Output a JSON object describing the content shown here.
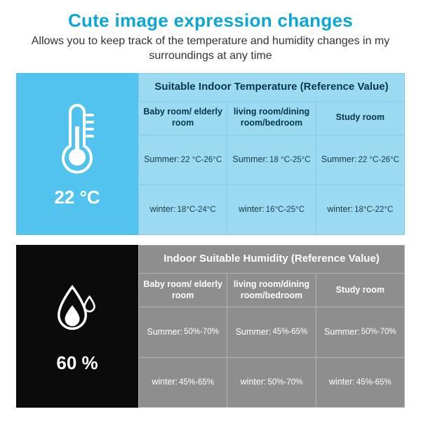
{
  "header": {
    "title": "Cute image expression changes",
    "subtitle": "Allows you to keep track of the temperature and humidity changes in my surroundings at any time"
  },
  "temperature": {
    "reading": "22 °C",
    "table_title": "Suitable Indoor Temperature (Reference Value)",
    "columns": [
      "Baby room/\nelderly room",
      "living room/dining room/bedroom",
      "Study room"
    ],
    "rows": [
      {
        "season": "Summer:",
        "values": [
          "22 °C-26°C",
          "18 °C-25°C",
          "22 °C-26°C"
        ]
      },
      {
        "season": "winter:",
        "values": [
          "18°C-24°C",
          "16°C-25°C",
          "18°C-22°C"
        ]
      }
    ]
  },
  "humidity": {
    "reading": "60 %",
    "table_title": "Indoor Suitable Humidity (Reference Value)",
    "columns": [
      "Baby room/\nelderly room",
      "living room/dining room/bedroom",
      "Study room"
    ],
    "rows": [
      {
        "season": "Summer:",
        "values": [
          "50%-70%",
          "45%-65%",
          "50%-70%"
        ]
      },
      {
        "season": "winter:",
        "values": [
          "45%-65%",
          "50%-70%",
          "45%-65%"
        ]
      }
    ]
  }
}
